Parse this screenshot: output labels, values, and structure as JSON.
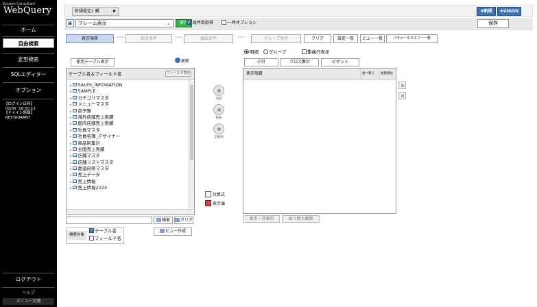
{
  "sidebar": {
    "logo_small": "System Consultant",
    "logo": "WebQuery",
    "nav": [
      {
        "label": "ホーム"
      },
      {
        "label": "自由検索"
      },
      {
        "label": "定型検索"
      },
      {
        "label": "SQLエディター"
      },
      {
        "label": "オプション"
      }
    ],
    "login_info": "【ログイン日時】\n 01/05  16:50:13\n【ドメイン情報】\n RESTAURANT",
    "logout": "ログアウト",
    "help": "ヘルプ",
    "menu_toggle": "メニュー切替"
  },
  "topbar": {
    "tab_label": "新規設定1 麟",
    "tab_close": "✖",
    "new_button": "✚新規",
    "union_button": "✚UNION"
  },
  "toolbar": {
    "frame_select_value": "フレーム表示",
    "execute_label": "実行",
    "chk_overall": "総件数取得",
    "chk_temp": "一時オプション",
    "save_label": "保存"
  },
  "steps": {
    "display_items": "表示項目",
    "join_conditions": "結合条件",
    "extract_conditions": "抽出条件",
    "group_conditions": "グループ条件",
    "clear": "クリア",
    "settings_list": "設定一覧",
    "view_list": "ビュー一覧",
    "param_query": "パラメータクエリー一覧"
  },
  "left": {
    "used_table_button": "使用テーブル表示",
    "refresh_label": "更新",
    "header": "テーブル名＆フィールド名",
    "field_display": "フィールド表示",
    "tables": [
      "SALES_INFOMATION",
      "SAMPLE",
      "カテゴリマスタ",
      "メニューマスタ",
      "前予算",
      "海外店舗売上実績",
      "国内店舗売上実績",
      "社員マスタ",
      "社員名簿_デザイナー",
      "商品別集計",
      "全国売上実績",
      "店舗マスタ",
      "店舗リストマスタ",
      "都道府県マスタ",
      "売上データ",
      "売上情報",
      "売上情報2023"
    ],
    "search_label": "検索",
    "clear_label": "クリア",
    "search_target_label": "検索対象",
    "chk_table_name": "テーブル名",
    "chk_field_name": "フィールド名",
    "view_create": "ビュー作成"
  },
  "middle": {
    "add_label": "追加",
    "delete_label": "削除",
    "delete_all_label": "全削除",
    "calc_label": "計算式",
    "display_value_label": "表示値"
  },
  "right": {
    "radio_detail": "明細",
    "radio_group": "グループ",
    "chk_duplicate": "重複行表示",
    "mode_total": "小計",
    "mode_cross": "クロス集計",
    "mode_pivot": "ピボット",
    "col_item": "表示項目",
    "col_sort": "並べ替え",
    "col_sort_order": "並替順位",
    "show_hide": "表示・非表示",
    "sort_cancel": "並べ替え解除"
  }
}
